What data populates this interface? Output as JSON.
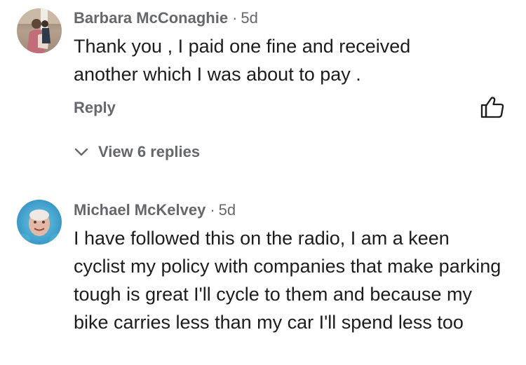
{
  "comments": [
    {
      "author": "Barbara McConaghie",
      "separator": "·",
      "time": "5d",
      "text": "Thank you , I paid one fine and received another which I was about to pay .",
      "reply_label": "Reply",
      "view_replies_label": "View 6 replies",
      "avatar_icon": "user-photo-avatar",
      "like_icon": "thumbs-up-icon"
    },
    {
      "author": "Michael McKelvey",
      "separator": "·",
      "time": "5d",
      "text": "I have followed this on the radio, I am a keen cyclist my policy with companies that make parking tough is great I'll cycle to them and because my bike carries less than my car I'll spend less too",
      "avatar_icon": "user-photo-avatar"
    }
  ],
  "colors": {
    "text": "#1c1c1c",
    "muted": "#65676b",
    "background": "#ffffff"
  }
}
